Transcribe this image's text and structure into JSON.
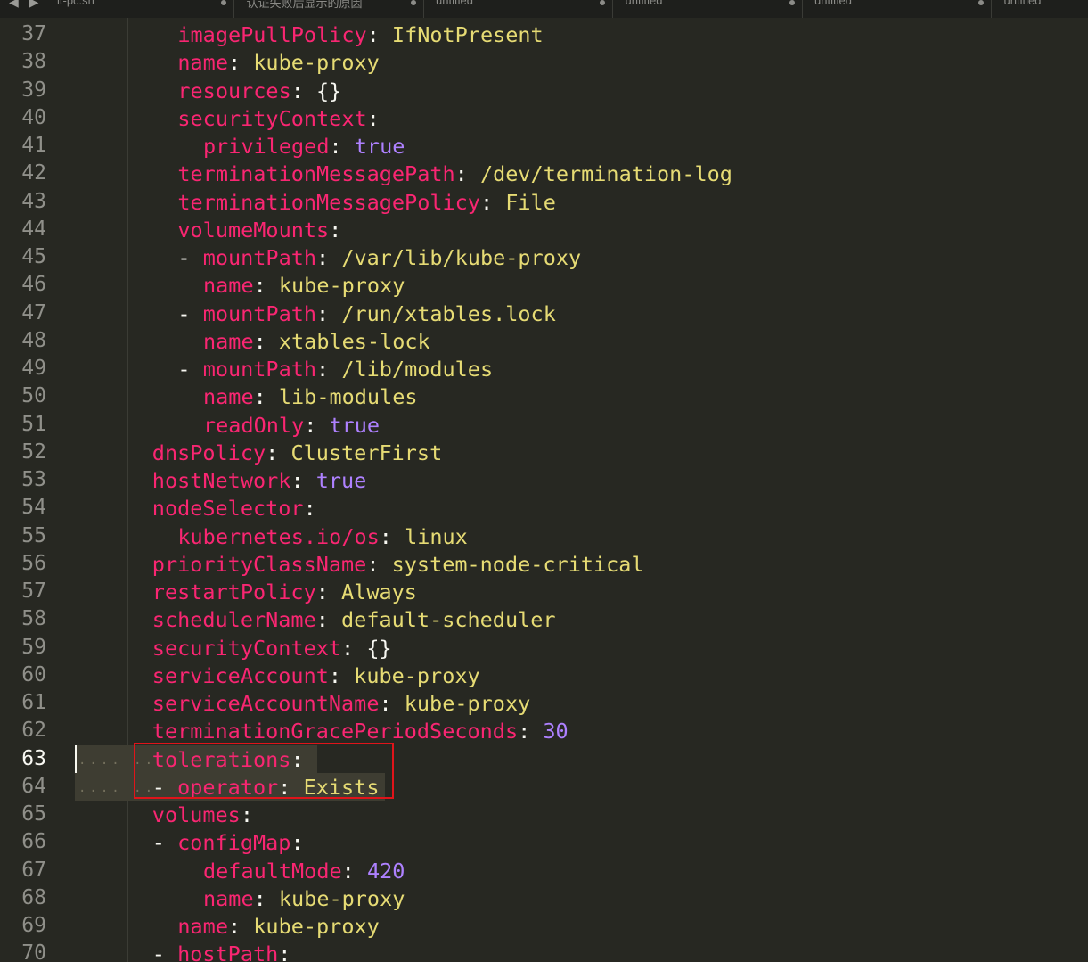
{
  "tabs": [
    {
      "label": "lt-pc.sh"
    },
    {
      "label": "认证失败后显示的原因"
    },
    {
      "label": "untitled"
    },
    {
      "label": "untitled"
    },
    {
      "label": "untitled"
    },
    {
      "label": "untitled"
    }
  ],
  "nav_icons": "◀ ▶",
  "current_line": 63,
  "annotation": {
    "color": "#e0141a",
    "lines": [
      63,
      64
    ]
  },
  "lines": [
    {
      "num": "37",
      "indent": 4,
      "tokens": [
        {
          "t": "imagePullPolicy",
          "c": "k"
        },
        {
          "t": ": ",
          "c": "p"
        },
        {
          "t": "IfNotPresent",
          "c": "s"
        }
      ]
    },
    {
      "num": "38",
      "indent": 4,
      "tokens": [
        {
          "t": "name",
          "c": "k"
        },
        {
          "t": ": ",
          "c": "p"
        },
        {
          "t": "kube-proxy",
          "c": "s"
        }
      ]
    },
    {
      "num": "39",
      "indent": 4,
      "tokens": [
        {
          "t": "resources",
          "c": "k"
        },
        {
          "t": ": {}",
          "c": "p"
        }
      ]
    },
    {
      "num": "40",
      "indent": 4,
      "tokens": [
        {
          "t": "securityContext",
          "c": "k"
        },
        {
          "t": ":",
          "c": "p"
        }
      ]
    },
    {
      "num": "41",
      "indent": 5,
      "tokens": [
        {
          "t": "privileged",
          "c": "k"
        },
        {
          "t": ": ",
          "c": "p"
        },
        {
          "t": "true",
          "c": "c"
        }
      ]
    },
    {
      "num": "42",
      "indent": 4,
      "tokens": [
        {
          "t": "terminationMessagePath",
          "c": "k"
        },
        {
          "t": ": ",
          "c": "p"
        },
        {
          "t": "/dev/termination-log",
          "c": "s"
        }
      ]
    },
    {
      "num": "43",
      "indent": 4,
      "tokens": [
        {
          "t": "terminationMessagePolicy",
          "c": "k"
        },
        {
          "t": ": ",
          "c": "p"
        },
        {
          "t": "File",
          "c": "s"
        }
      ]
    },
    {
      "num": "44",
      "indent": 4,
      "tokens": [
        {
          "t": "volumeMounts",
          "c": "k"
        },
        {
          "t": ":",
          "c": "p"
        }
      ]
    },
    {
      "num": "45",
      "indent": 4,
      "tokens": [
        {
          "t": "- ",
          "c": "p"
        },
        {
          "t": "mountPath",
          "c": "k"
        },
        {
          "t": ": ",
          "c": "p"
        },
        {
          "t": "/var/lib/kube-proxy",
          "c": "s"
        }
      ]
    },
    {
      "num": "46",
      "indent": 5,
      "tokens": [
        {
          "t": "name",
          "c": "k"
        },
        {
          "t": ": ",
          "c": "p"
        },
        {
          "t": "kube-proxy",
          "c": "s"
        }
      ]
    },
    {
      "num": "47",
      "indent": 4,
      "tokens": [
        {
          "t": "- ",
          "c": "p"
        },
        {
          "t": "mountPath",
          "c": "k"
        },
        {
          "t": ": ",
          "c": "p"
        },
        {
          "t": "/run/xtables.lock",
          "c": "s"
        }
      ]
    },
    {
      "num": "48",
      "indent": 5,
      "tokens": [
        {
          "t": "name",
          "c": "k"
        },
        {
          "t": ": ",
          "c": "p"
        },
        {
          "t": "xtables-lock",
          "c": "s"
        }
      ]
    },
    {
      "num": "49",
      "indent": 4,
      "tokens": [
        {
          "t": "- ",
          "c": "p"
        },
        {
          "t": "mountPath",
          "c": "k"
        },
        {
          "t": ": ",
          "c": "p"
        },
        {
          "t": "/lib/modules",
          "c": "s"
        }
      ]
    },
    {
      "num": "50",
      "indent": 5,
      "tokens": [
        {
          "t": "name",
          "c": "k"
        },
        {
          "t": ": ",
          "c": "p"
        },
        {
          "t": "lib-modules",
          "c": "s"
        }
      ]
    },
    {
      "num": "51",
      "indent": 5,
      "tokens": [
        {
          "t": "readOnly",
          "c": "k"
        },
        {
          "t": ": ",
          "c": "p"
        },
        {
          "t": "true",
          "c": "c"
        }
      ]
    },
    {
      "num": "52",
      "indent": 3,
      "tokens": [
        {
          "t": "dnsPolicy",
          "c": "k"
        },
        {
          "t": ": ",
          "c": "p"
        },
        {
          "t": "ClusterFirst",
          "c": "s"
        }
      ]
    },
    {
      "num": "53",
      "indent": 3,
      "tokens": [
        {
          "t": "hostNetwork",
          "c": "k"
        },
        {
          "t": ": ",
          "c": "p"
        },
        {
          "t": "true",
          "c": "c"
        }
      ]
    },
    {
      "num": "54",
      "indent": 3,
      "tokens": [
        {
          "t": "nodeSelector",
          "c": "k"
        },
        {
          "t": ":",
          "c": "p"
        }
      ]
    },
    {
      "num": "55",
      "indent": 4,
      "tokens": [
        {
          "t": "kubernetes.io/os",
          "c": "k"
        },
        {
          "t": ": ",
          "c": "p"
        },
        {
          "t": "linux",
          "c": "s"
        }
      ]
    },
    {
      "num": "56",
      "indent": 3,
      "tokens": [
        {
          "t": "priorityClassName",
          "c": "k"
        },
        {
          "t": ": ",
          "c": "p"
        },
        {
          "t": "system-node-critical",
          "c": "s"
        }
      ]
    },
    {
      "num": "57",
      "indent": 3,
      "tokens": [
        {
          "t": "restartPolicy",
          "c": "k"
        },
        {
          "t": ": ",
          "c": "p"
        },
        {
          "t": "Always",
          "c": "s"
        }
      ]
    },
    {
      "num": "58",
      "indent": 3,
      "tokens": [
        {
          "t": "schedulerName",
          "c": "k"
        },
        {
          "t": ": ",
          "c": "p"
        },
        {
          "t": "default-scheduler",
          "c": "s"
        }
      ]
    },
    {
      "num": "59",
      "indent": 3,
      "tokens": [
        {
          "t": "securityContext",
          "c": "k"
        },
        {
          "t": ": {}",
          "c": "p"
        }
      ]
    },
    {
      "num": "60",
      "indent": 3,
      "tokens": [
        {
          "t": "serviceAccount",
          "c": "k"
        },
        {
          "t": ": ",
          "c": "p"
        },
        {
          "t": "kube-proxy",
          "c": "s"
        }
      ]
    },
    {
      "num": "61",
      "indent": 3,
      "tokens": [
        {
          "t": "serviceAccountName",
          "c": "k"
        },
        {
          "t": ": ",
          "c": "p"
        },
        {
          "t": "kube-proxy",
          "c": "s"
        }
      ]
    },
    {
      "num": "62",
      "indent": 3,
      "tokens": [
        {
          "t": "terminationGracePeriodSeconds",
          "c": "k"
        },
        {
          "t": ": ",
          "c": "p"
        },
        {
          "t": "30",
          "c": "c"
        }
      ]
    },
    {
      "num": "63",
      "indent": 3,
      "tokens": [
        {
          "t": "tolerations",
          "c": "k"
        },
        {
          "t": ":",
          "c": "p"
        }
      ]
    },
    {
      "num": "64",
      "indent": 3,
      "tokens": [
        {
          "t": "- ",
          "c": "p"
        },
        {
          "t": "operator",
          "c": "k"
        },
        {
          "t": ": ",
          "c": "p"
        },
        {
          "t": "Exists",
          "c": "s"
        }
      ]
    },
    {
      "num": "65",
      "indent": 3,
      "tokens": [
        {
          "t": "volumes",
          "c": "k"
        },
        {
          "t": ":",
          "c": "p"
        }
      ]
    },
    {
      "num": "66",
      "indent": 3,
      "tokens": [
        {
          "t": "- ",
          "c": "p"
        },
        {
          "t": "configMap",
          "c": "k"
        },
        {
          "t": ":",
          "c": "p"
        }
      ]
    },
    {
      "num": "67",
      "indent": 5,
      "tokens": [
        {
          "t": "defaultMode",
          "c": "k"
        },
        {
          "t": ": ",
          "c": "p"
        },
        {
          "t": "420",
          "c": "c"
        }
      ]
    },
    {
      "num": "68",
      "indent": 5,
      "tokens": [
        {
          "t": "name",
          "c": "k"
        },
        {
          "t": ": ",
          "c": "p"
        },
        {
          "t": "kube-proxy",
          "c": "s"
        }
      ]
    },
    {
      "num": "69",
      "indent": 4,
      "tokens": [
        {
          "t": "name",
          "c": "k"
        },
        {
          "t": ": ",
          "c": "p"
        },
        {
          "t": "kube-proxy",
          "c": "s"
        }
      ]
    },
    {
      "num": "70",
      "indent": 3,
      "tokens": [
        {
          "t": "- ",
          "c": "p"
        },
        {
          "t": "hostPath",
          "c": "k"
        },
        {
          "t": ":",
          "c": "p"
        }
      ]
    }
  ]
}
